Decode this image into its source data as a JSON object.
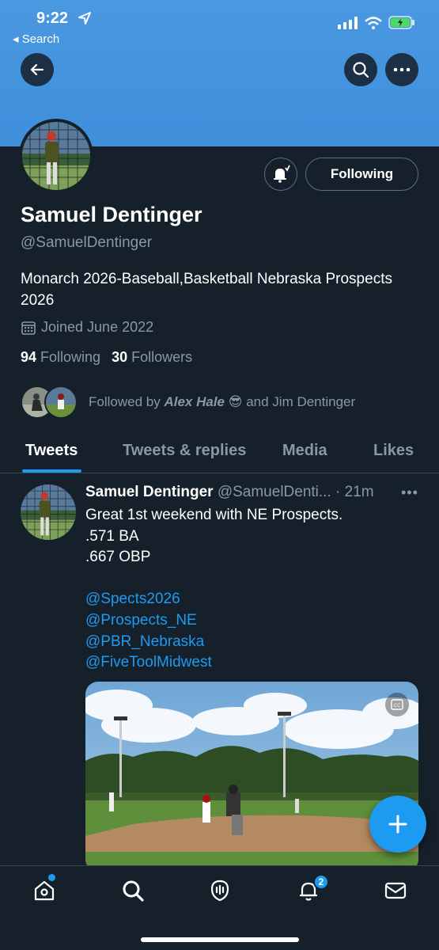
{
  "status_bar": {
    "time": "9:22",
    "back_label": "◂ Search"
  },
  "profile": {
    "name": "Samuel Dentinger",
    "handle": "@SamuelDentinger",
    "bio": "Monarch 2026-Baseball,Basketball Nebraska Prospects 2026",
    "joined": "Joined June 2022",
    "following_count": "94",
    "following_label": "Following",
    "followers_count": "30",
    "followers_label": "Followers",
    "follow_button": "Following",
    "followed_by_prefix": "Followed by",
    "followed_by_name1": "Alex Hale",
    "followed_by_emoji": "😎",
    "followed_by_suffix": "and Jim Dentinger"
  },
  "tabs": [
    "Tweets",
    "Tweets & replies",
    "Media",
    "Likes"
  ],
  "tweet": {
    "name": "Samuel Dentinger",
    "meta": "@SamuelDenti... · 21m",
    "more": "•••",
    "lines": [
      "Great 1st weekend with NE Prospects.",
      ".571 BA",
      ".667 OBP",
      ""
    ],
    "mentions": [
      "@Spects2026",
      "@Prospects_NE",
      "@PBR_Nebraska",
      "@FiveToolMidwest"
    ]
  },
  "nav": {
    "notification_badge": "2"
  },
  "colors": {
    "background": "#15202b",
    "banner": "#4a98e0",
    "accent": "#1d9bf0",
    "secondary_text": "#8899a6"
  },
  "icons": [
    "back-arrow-icon",
    "search-icon",
    "more-icon",
    "bell-notify-icon",
    "calendar-icon",
    "cc-icon",
    "plus-icon",
    "home-icon",
    "spaces-icon",
    "notifications-icon",
    "mail-icon"
  ]
}
